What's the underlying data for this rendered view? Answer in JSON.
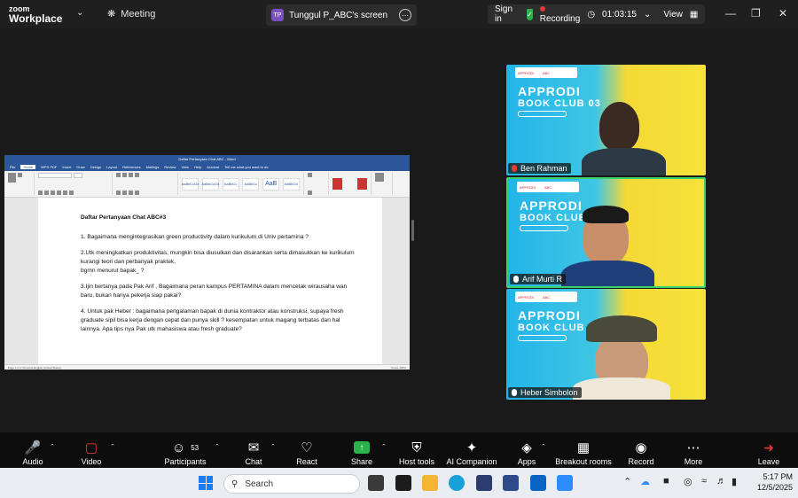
{
  "titlebar": {
    "brand_line1": "zoom",
    "brand_line2": "Workplace",
    "meeting_label": "Meeting",
    "share_initials": "TP",
    "share_label": "Tunggul P_ABC's screen",
    "signin": "Sign in",
    "recording": "Recording",
    "timer": "01:03:15",
    "view": "View"
  },
  "document": {
    "window_title": "Daftar Pertanyaan Chat ABC  -  Word",
    "ribbon_tabs": [
      "File",
      "Home",
      "WPS PDF",
      "Insert",
      "Draw",
      "Design",
      "Layout",
      "References",
      "Mailings",
      "Review",
      "View",
      "Help",
      "Acrobat",
      "Tell me what you want to do"
    ],
    "heading": "Daftar Pertanyaan Chat ABC#3",
    "q1": "1. Bagaimana mengintegrasikan green productivity dalam kurikulum di Univ pertamina ?",
    "q2a": "2.Utk meningkatkan produktivitas, mungkin bisa diusulkan dan disarankan serta dimasukkan ke kurikulum kurangi teori dan perbanyak praktek,",
    "q2b": "bgmn menurut bapak_ ?",
    "q3": "3.Ijin bertanya pada Pak Arif , Bagaimana peran kampus PERTAMINA dalam mencetak wirausaha wan baru, bukan hanya pekerja siap pakai?",
    "q4": "4. Untuk pak Heber : bagaimana pengalaman bapak di dunia kontraktor atau konstruksi, supaya fresh graduate sipil bisa kerja dengan cepat dan punya skill ? kesempatan untuk magang terbatas dan hal lainnya. Apa tips nya Pak utk mahasiswa atau fresh graduate?",
    "status_left": "Page 1 of 1     30 words     English (United States)",
    "status_right": "Focus     100%"
  },
  "tiles": [
    {
      "name": "Ben Rahman",
      "muted": true,
      "title1": "APPRODI",
      "title2": "BOOK CLUB 03"
    },
    {
      "name": "Arif Murti R",
      "muted": false,
      "title1": "APPRODI",
      "title2": "BOOK CLUB 03"
    },
    {
      "name": "Heber Simbolon",
      "muted": false,
      "title1": "APPRODI",
      "title2": "BOOK CLUB 03"
    }
  ],
  "toolbar": {
    "audio": "Audio",
    "video": "Video",
    "participants": "Participants",
    "participants_count": "53",
    "chat": "Chat",
    "react": "React",
    "share": "Share",
    "host_tools": "Host tools",
    "ai_companion": "AI Companion",
    "apps": "Apps",
    "breakout": "Breakout rooms",
    "record": "Record",
    "more": "More",
    "leave": "Leave"
  },
  "taskbar": {
    "search_placeholder": "Search",
    "time": "5:17 PM",
    "date": "12/5/2025"
  },
  "colors": {
    "accent_green": "#2cb24a",
    "recording_red": "#e53935",
    "word_blue": "#2b579a",
    "speaker_border": "#3cd26a"
  }
}
